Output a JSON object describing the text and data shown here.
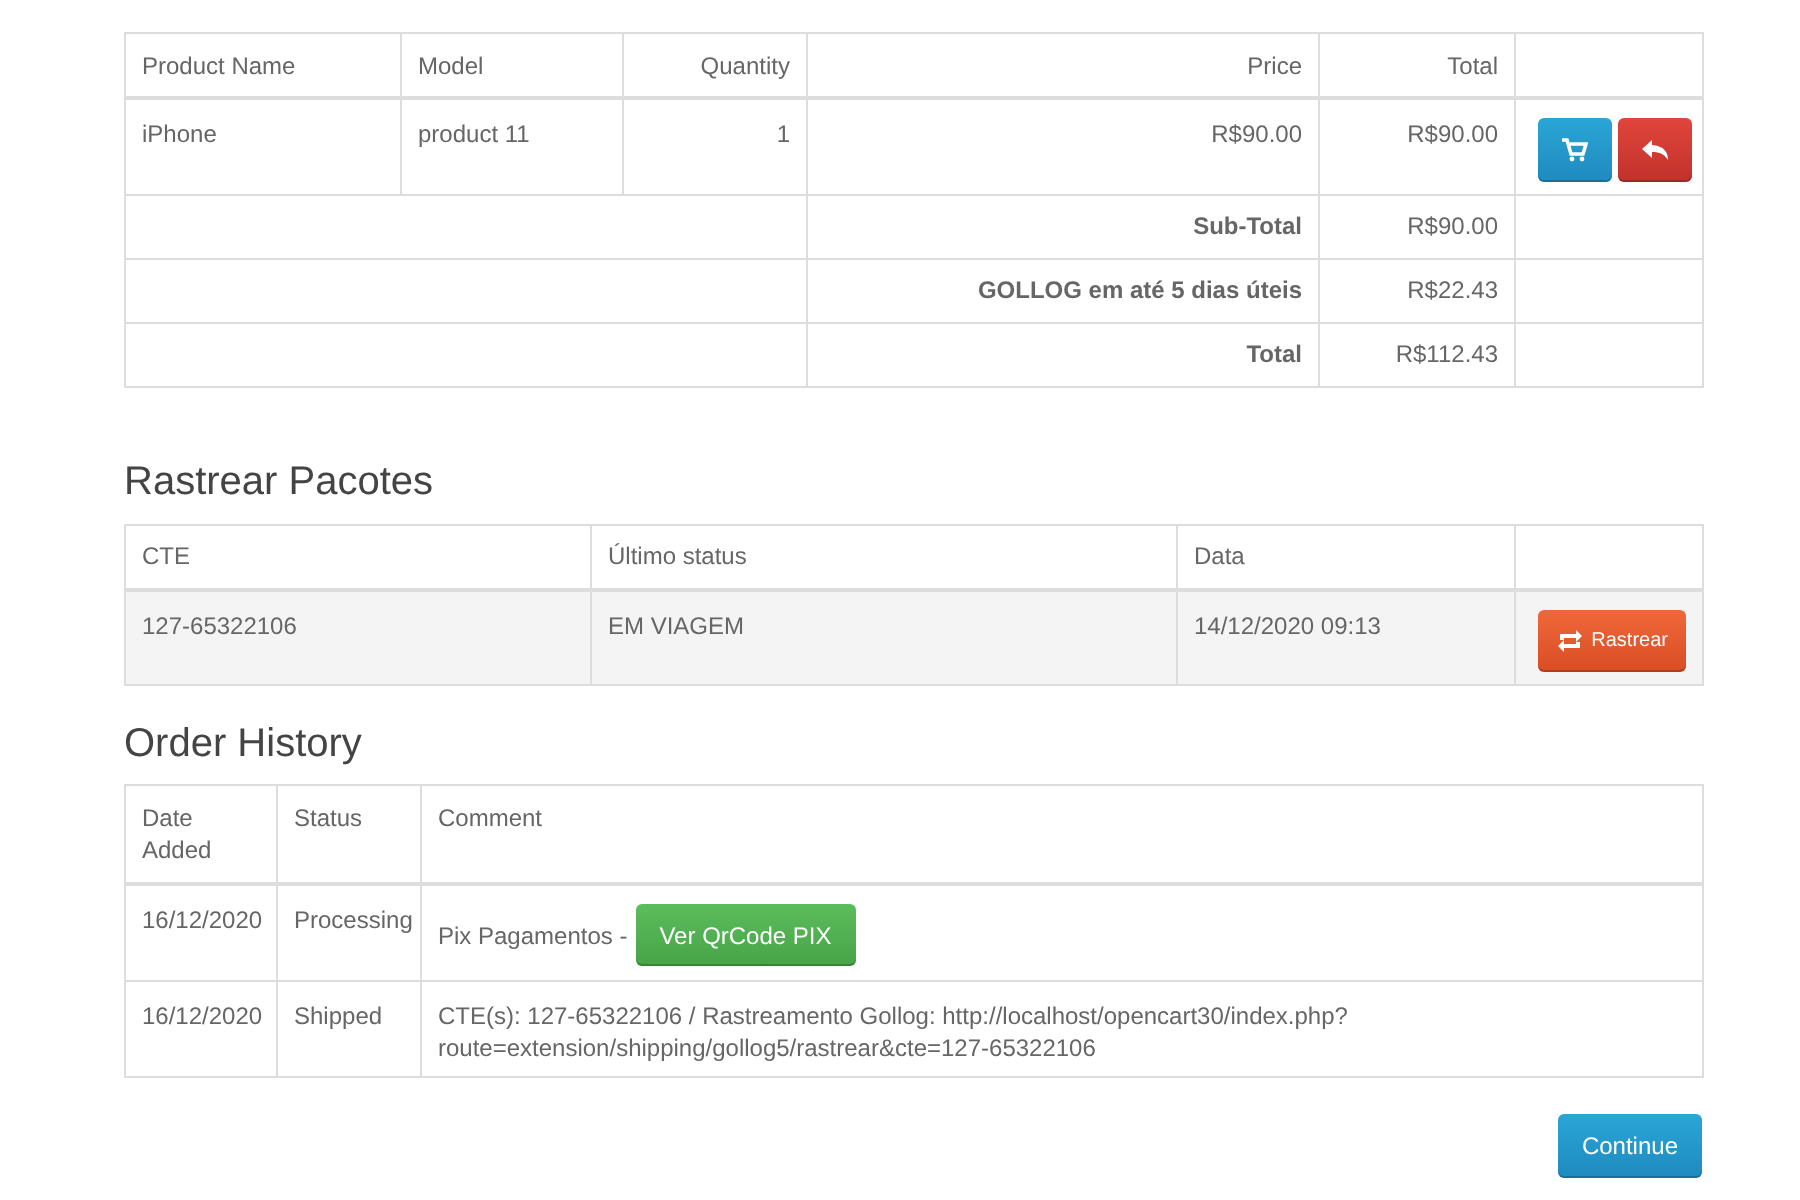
{
  "order_table": {
    "columns": [
      "Product Name",
      "Model",
      "Quantity",
      "Price",
      "Total"
    ],
    "rows": [
      {
        "product_name": "iPhone",
        "model": "product 11",
        "quantity": "1",
        "price": "R$90.00",
        "total": "R$90.00"
      }
    ],
    "totals": [
      {
        "label": "Sub-Total",
        "value": "R$90.00"
      },
      {
        "label": "GOLLOG em até 5 dias úteis",
        "value": "R$22.43"
      },
      {
        "label": "Total",
        "value": "R$112.43"
      }
    ]
  },
  "tracking": {
    "title": "Rastrear Pacotes",
    "columns": [
      "CTE",
      "Último status",
      "Data"
    ],
    "rows": [
      {
        "cte": "127-65322106",
        "status": "EM VIAGEM",
        "date": "14/12/2020 09:13",
        "button": "Rastrear"
      }
    ]
  },
  "history": {
    "title": "Order History",
    "columns": [
      "Date Added",
      "Status",
      "Comment"
    ],
    "rows": [
      {
        "date": "16/12/2020",
        "status": "Processing",
        "comment": "Pix Pagamentos -",
        "button": "Ver QrCode PIX"
      },
      {
        "date": "16/12/2020",
        "status": "Shipped",
        "comment": "CTE(s): 127-65322106 / Rastreamento Gollog: http://localhost/opencart30/index.php?route=extension/shipping/gollog5/rastrear&cte=127-65322106"
      }
    ]
  },
  "continue_button": "Continue"
}
